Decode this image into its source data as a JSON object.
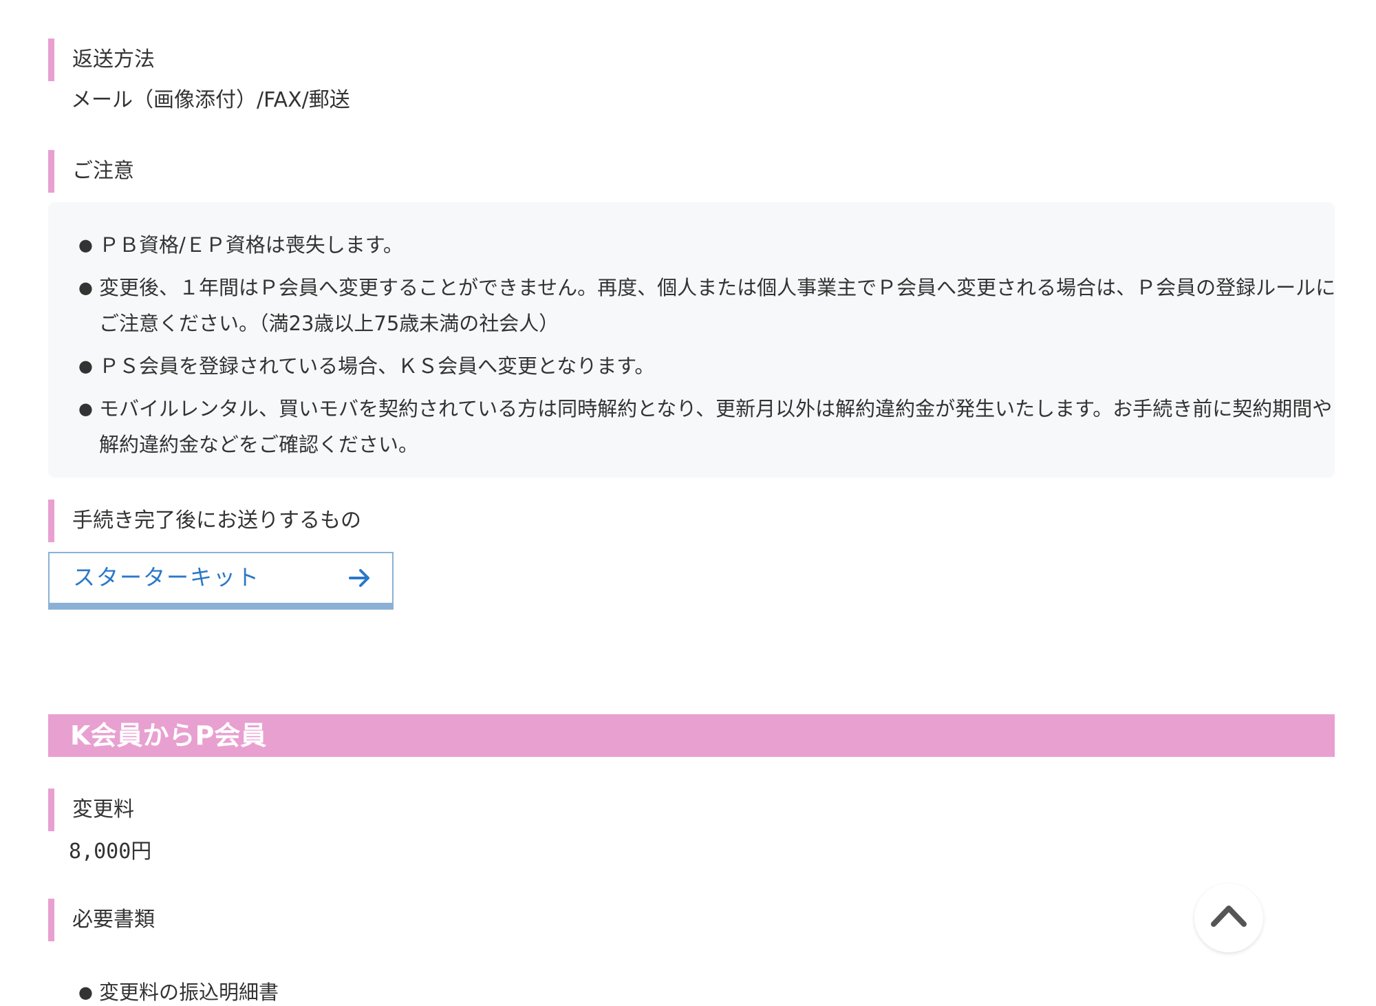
{
  "return_method": {
    "label": "返送方法",
    "value": "メール（画像添付）/FAX/郵送"
  },
  "caution": {
    "label": "ご注意",
    "items": [
      "ＰＢ資格/ＥＰ資格は喪失します。",
      "変更後、１年間はＰ会員へ変更することができません。再度、個人または個人事業主でＰ会員へ変更される場合は、Ｐ会員の登録ルールにご注意ください。（満23歳以上75歳未満の社会人）",
      "ＰＳ会員を登録されている場合、ＫＳ会員へ変更となります。",
      "モバイルレンタル、買いモバを契約されている方は同時解約となり、更新月以外は解約違約金が発生いたします。お手続き前に契約期間や解約違約金などをご確認ください。"
    ]
  },
  "after_procedure": {
    "label": "手続き完了後にお送りするもの",
    "link_label": "スターターキット",
    "link_icon": "arrow-right-icon"
  },
  "k_to_p": {
    "heading": "K会員からP会員",
    "fee": {
      "label": "変更料",
      "value": "8,000円"
    },
    "required_docs": {
      "label": "必要書類",
      "items": [
        "変更料の振込明細書"
      ]
    }
  },
  "back_to_top": {
    "icon": "chevron-up-icon"
  },
  "colors": {
    "accent_pink": "#e8a0d0",
    "link_blue": "#2a78c8",
    "link_border": "#8ab1d5",
    "notes_bg": "#f6f8f9"
  }
}
